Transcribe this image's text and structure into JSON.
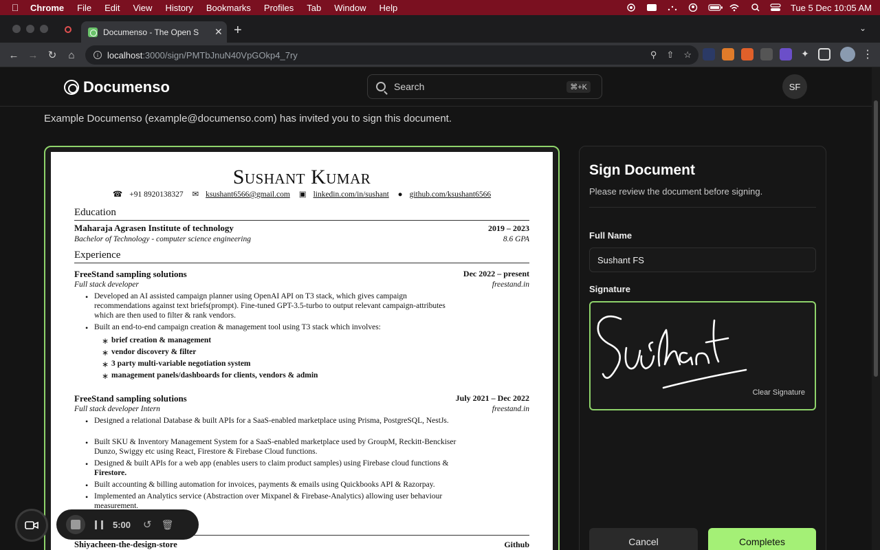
{
  "menubar": {
    "app": "Chrome",
    "items": [
      "File",
      "Edit",
      "View",
      "History",
      "Bookmarks",
      "Profiles",
      "Tab",
      "Window",
      "Help"
    ],
    "clock": "Tue 5 Dec  10:05 AM"
  },
  "browser": {
    "tab_title": "Documenso - The Open S",
    "url_host": "localhost",
    "url_path": ":3000/sign/PMTbJnuN40VpGOkp4_7ry"
  },
  "site": {
    "brand": "Documenso",
    "search_placeholder": "Search",
    "search_shortcut": "⌘+K",
    "avatar_initials": "SF",
    "invite_text": "Example Documenso (example@documenso.com) has invited you to sign this document."
  },
  "resume": {
    "name": "Sushant Kumar",
    "phone": "+91 8920138327",
    "email": "ksushant6566@gmail.com",
    "linkedin": "linkedin.com/in/sushant",
    "github": "github.com/ksushant6566",
    "education_heading": "Education",
    "edu_school": "Maharaja Agrasen Institute of technology",
    "edu_years": "2019 – 2023",
    "edu_degree": "Bachelor of Technology - computer science engineering",
    "edu_gpa": "8.6 GPA",
    "experience_heading": "Experience",
    "job1_company": "FreeStand sampling solutions",
    "job1_dates": "Dec 2022 – present",
    "job1_role": "Full stack developer",
    "job1_site": "freestand.in",
    "job1_b1_l1": "Developed an AI assisted campaign planner using OpenAI API on T3 stack, which gives campaign",
    "job1_b1_l2": "recommendations against text briefs(prompt). Fine-tuned GPT-3.5-turbo to output relevant campaign-attributes",
    "job1_b1_l3": "which are then used to filter & rank vendors.",
    "job1_b2": "Built an end-to-end campaign creation & management tool using T3 stack which involves:",
    "job1_sub1": "brief creation & management",
    "job1_sub2": "vendor discovery & filter",
    "job1_sub3": "3 party multi-variable negotiation system",
    "job1_sub4": "management panels/dashboards for clients, vendors & admin",
    "job2_company": "FreeStand sampling solutions",
    "job2_dates": "July 2021 – Dec 2022",
    "job2_role": "Full stack developer Intern",
    "job2_site": "freestand.in",
    "job2_b1": "Designed a relational Database & built APIs for a SaaS-enabled marketplace using Prisma, PostgreSQL, NestJs.",
    "job2_b2_l1": "Built SKU & Inventory Management System for a SaaS-enabled marketplace used by GroupM, Reckitt-Benckiser",
    "job2_b2_l2": "Dunzo, Swiggy etc using React, Firestore & Firebase Cloud functions.",
    "job2_b3_l1": "Designed & built APIs for a web app (enables users to claim product samples) using Firebase cloud functions &",
    "job2_b3_l2": "Firestore.",
    "job2_b4": "Built accounting & billing automation for invoices, payments & emails using Quickbooks API & Razorpay.",
    "job2_b5_l1": "Implemented an Analytics service (Abstraction over Mixpanel & Firebase-Analytics) allowing user behaviour",
    "job2_b5_l2": "measurement.",
    "proj_name": "Shiyacheen-the-design-store",
    "proj_link": "Github"
  },
  "sign_panel": {
    "title": "Sign Document",
    "subtitle": "Please review the document before signing.",
    "full_name_label": "Full Name",
    "full_name_value": "Sushant FS",
    "signature_label": "Signature",
    "clear_signature": "Clear Signature",
    "cancel": "Cancel",
    "complete": "Completes"
  },
  "recorder": {
    "time": "5:00"
  },
  "colors": {
    "accent": "#a4f076",
    "frame": "#8fd46b",
    "menubar": "#7a1020"
  }
}
